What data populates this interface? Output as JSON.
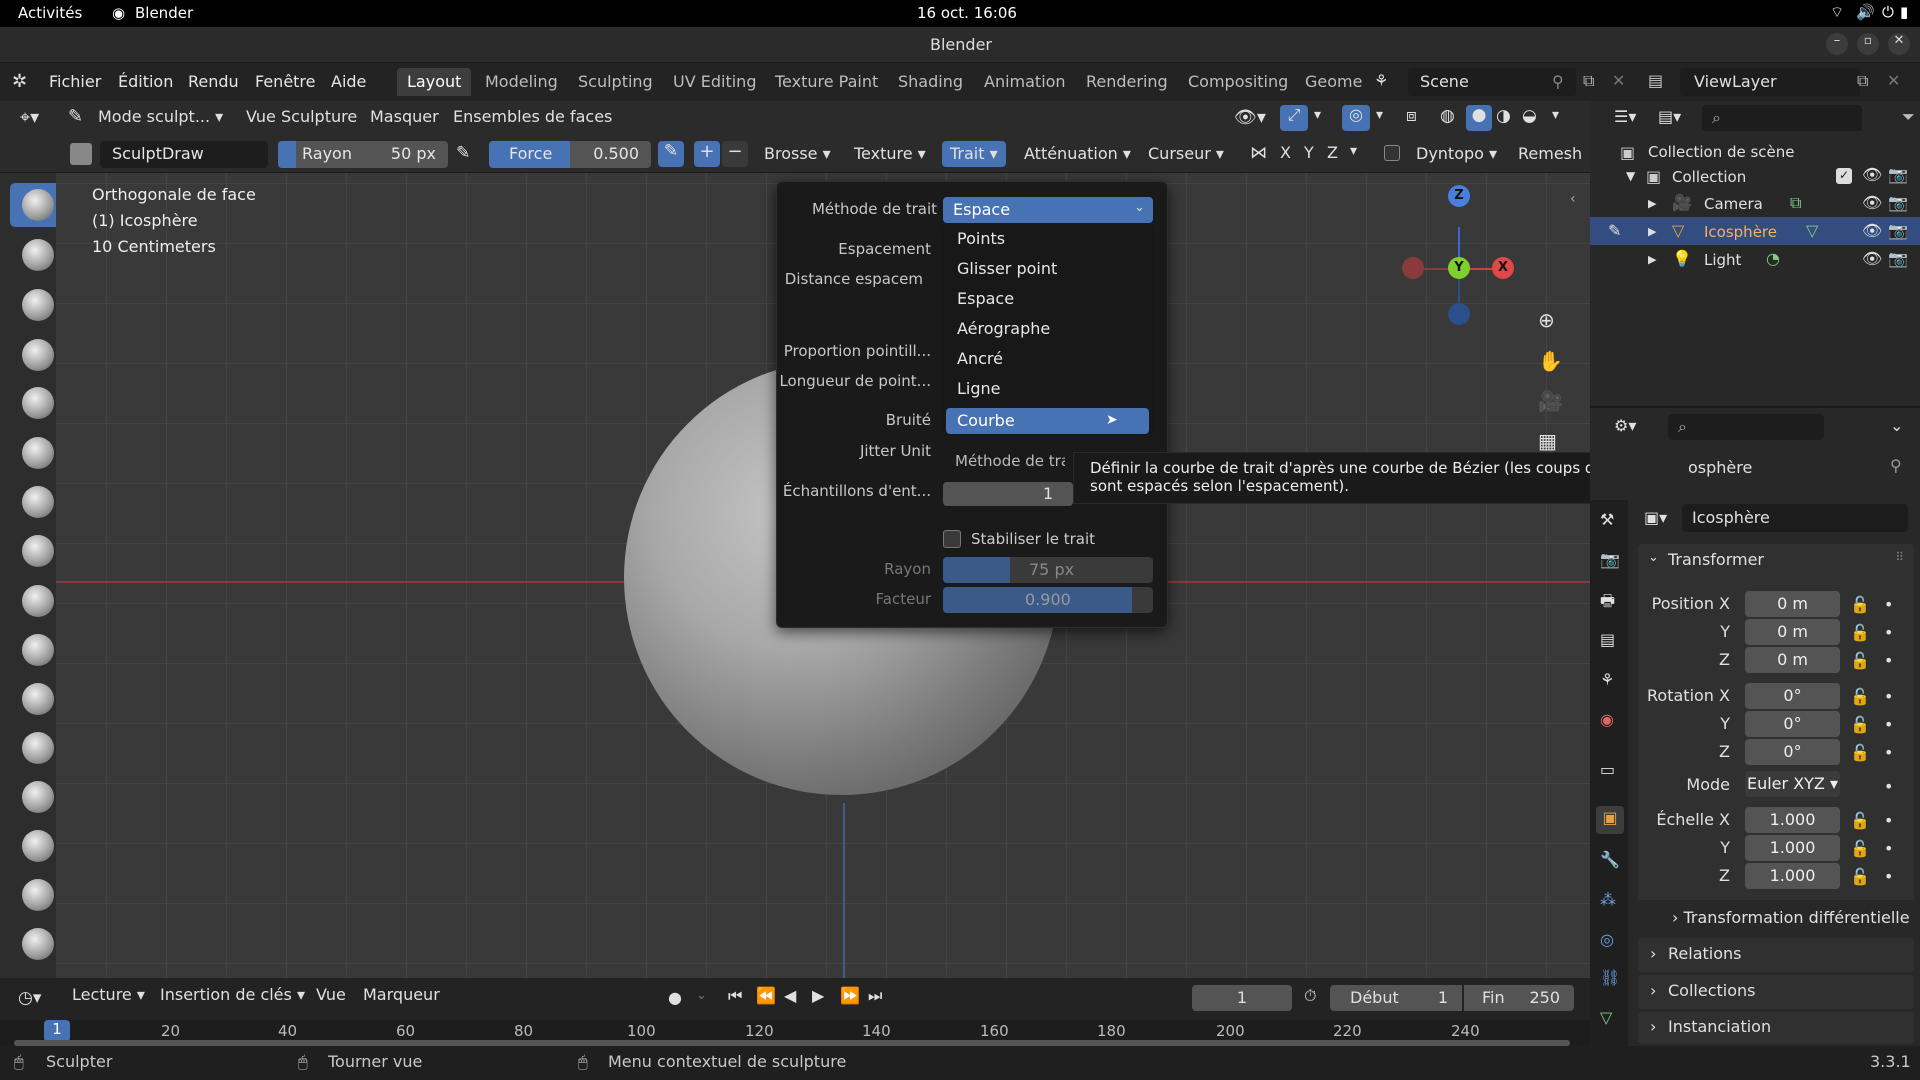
{
  "os": {
    "activities": "Activités",
    "app": "Blender",
    "datetime": "16 oct.  16:06"
  },
  "window": {
    "title": "Blender"
  },
  "menu": {
    "items": [
      "Fichier",
      "Édition",
      "Rendu",
      "Fenêtre",
      "Aide"
    ]
  },
  "workspaces": [
    "Layout",
    "Modeling",
    "Sculpting",
    "UV Editing",
    "Texture Paint",
    "Shading",
    "Animation",
    "Rendering",
    "Compositing",
    "Geome"
  ],
  "scene": {
    "name": "Scene",
    "view_layer": "ViewLayer"
  },
  "header": {
    "mode": "Mode sculpt...",
    "vue": "Vue",
    "sculpture": "Sculpture",
    "masquer": "Masquer",
    "face_sets": "Ensembles de faces"
  },
  "tool": {
    "brush_name": "SculptDraw",
    "rayon_label": "Rayon",
    "rayon_value": "50 px",
    "force_label": "Force",
    "force_value": "0.500",
    "brosse": "Brosse",
    "texture": "Texture",
    "trait": "Trait",
    "attenuation": "Atténuation",
    "curseur": "Curseur",
    "x": "X",
    "y": "Y",
    "z": "Z",
    "dyntopo": "Dyntopo",
    "remesh": "Remesh"
  },
  "viewport": {
    "line1": "Orthogonale de face",
    "line2": "(1) Icosphère",
    "line3": "10 Centimeters"
  },
  "gizmo": {
    "x": "X",
    "y": "Y",
    "z": "Z"
  },
  "stroke_popup": {
    "method_label": "Méthode de trait",
    "method_value": "Espace",
    "espacement": "Espacement",
    "distance": "Distance espacem",
    "proportion": "Proportion pointill...",
    "longueur": "Longueur de point...",
    "bruite": "Bruité",
    "jitter": "Jitter Unit",
    "echantillons": "Échantillons d'ent...",
    "echantillons_value": "1",
    "method_label2": "Méthode de trait",
    "stabiliser": "Stabiliser le trait",
    "rayon_label": "Rayon",
    "rayon_value": "75 px",
    "rayon_fill": 0.32,
    "facteur_label": "Facteur",
    "facteur_value": "0.900",
    "facteur_fill": 0.9
  },
  "dropdown": {
    "options": [
      "Points",
      "Glisser point",
      "Espace",
      "Aérographe",
      "Ancré",
      "Ligne",
      "Courbe"
    ],
    "selected": "Courbe"
  },
  "tooltip": {
    "text": "Définir la courbe de trait d'après une courbe de Bézier (les coups de pinceau sont espacés selon l'espacement)."
  },
  "outliner": {
    "root": "Collection de scène",
    "collection": "Collection",
    "items": [
      "Camera",
      "Icosphère",
      "Light"
    ]
  },
  "properties": {
    "object_name_partial": "osphère",
    "object_name": "Icosphère",
    "transform_header": "Transformer",
    "position": {
      "label": "Position X",
      "x": "0 m",
      "y": "0 m",
      "z": "0 m"
    },
    "rotation": {
      "label": "Rotation X",
      "x": "0°",
      "y": "0°",
      "z": "0°"
    },
    "mode_label": "Mode",
    "mode_value": "Euler XYZ",
    "scale": {
      "label": "Échelle X",
      "x": "1.000",
      "y": "1.000",
      "z": "1.000"
    },
    "axis_y": "Y",
    "axis_z": "Z",
    "delta": "Transformation différentielle",
    "relations": "Relations",
    "collections": "Collections",
    "instancing": "Instanciation"
  },
  "timeline": {
    "lecture": "Lecture",
    "keying": "Insertion de clés",
    "vue": "Vue",
    "marqueur": "Marqueur",
    "current_frame": "1",
    "start_label": "Début",
    "start_value": "1",
    "end_label": "Fin",
    "end_value": "250",
    "ruler_current": "1",
    "ruler": [
      "20",
      "40",
      "60",
      "80",
      "100",
      "120",
      "140",
      "160",
      "180",
      "200",
      "220",
      "240"
    ]
  },
  "status": {
    "sculpt": "Sculpter",
    "rotate": "Tourner vue",
    "context": "Menu contextuel de sculpture",
    "version": "3.3.1"
  }
}
